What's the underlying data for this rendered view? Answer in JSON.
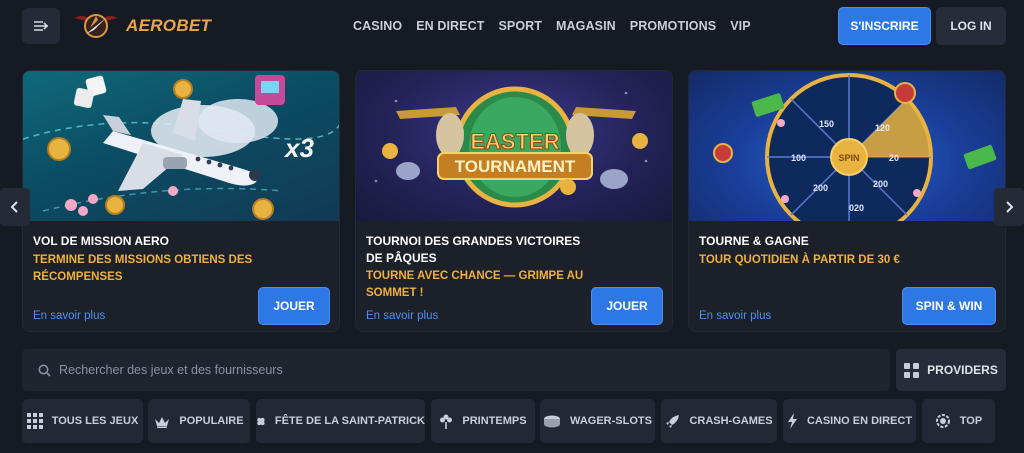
{
  "header": {
    "logo_text": "AEROBET",
    "nav": [
      "CASINO",
      "EN DIRECT",
      "SPORT",
      "MAGASIN",
      "PROMOTIONS",
      "VIP"
    ],
    "register_label": "S'INSCRIRE",
    "login_label": "LOG IN"
  },
  "promos": [
    {
      "title": "VOL DE MISSION AERO",
      "subtitle": "TERMINE DES MISSIONS OBTIENS DES RÉCOMPENSES",
      "link": "En savoir plus",
      "button": "JOUER",
      "badge": "x3"
    },
    {
      "title": "TOURNOI DES GRANDES VICTOIRES DE PÂQUES",
      "subtitle": "TOURNE AVEC CHANCE — GRIMPE AU SOMMET !",
      "link": "En savoir plus",
      "button": "JOUER",
      "badge_line1": "EASTER",
      "badge_line2": "TOURNAMENT"
    },
    {
      "title": "TOURNE & GAGNE",
      "subtitle": "TOUR QUOTIDIEN À PARTIR DE 30 €",
      "link": "En savoir plus",
      "button": "SPIN & WIN",
      "wheel_center": "SPIN",
      "wheel_values": [
        "20",
        "120",
        "200",
        "150",
        "100",
        "200",
        "020"
      ]
    }
  ],
  "search": {
    "placeholder": "Rechercher des jeux et des fournisseurs",
    "providers_label": "PROVIDERS"
  },
  "categories": [
    {
      "label": "TOUS LES JEUX",
      "icon": "grid-icon"
    },
    {
      "label": "POPULAIRE",
      "icon": "crown-icon"
    },
    {
      "label": "FÊTE DE LA SAINT-PATRICK",
      "icon": "clover-icon"
    },
    {
      "label": "PRINTEMPS",
      "icon": "flower-icon"
    },
    {
      "label": "WAGER-SLOTS",
      "icon": "coins-icon"
    },
    {
      "label": "CRASH-GAMES",
      "icon": "rocket-icon"
    },
    {
      "label": "CASINO EN DIRECT",
      "icon": "lightning-icon"
    },
    {
      "label": "TOP",
      "icon": "medal-icon"
    }
  ],
  "colors": {
    "background": "#161a23",
    "accent_blue": "#2e78e6",
    "accent_gold": "#f0b03c",
    "link_blue": "#4d90f0"
  }
}
